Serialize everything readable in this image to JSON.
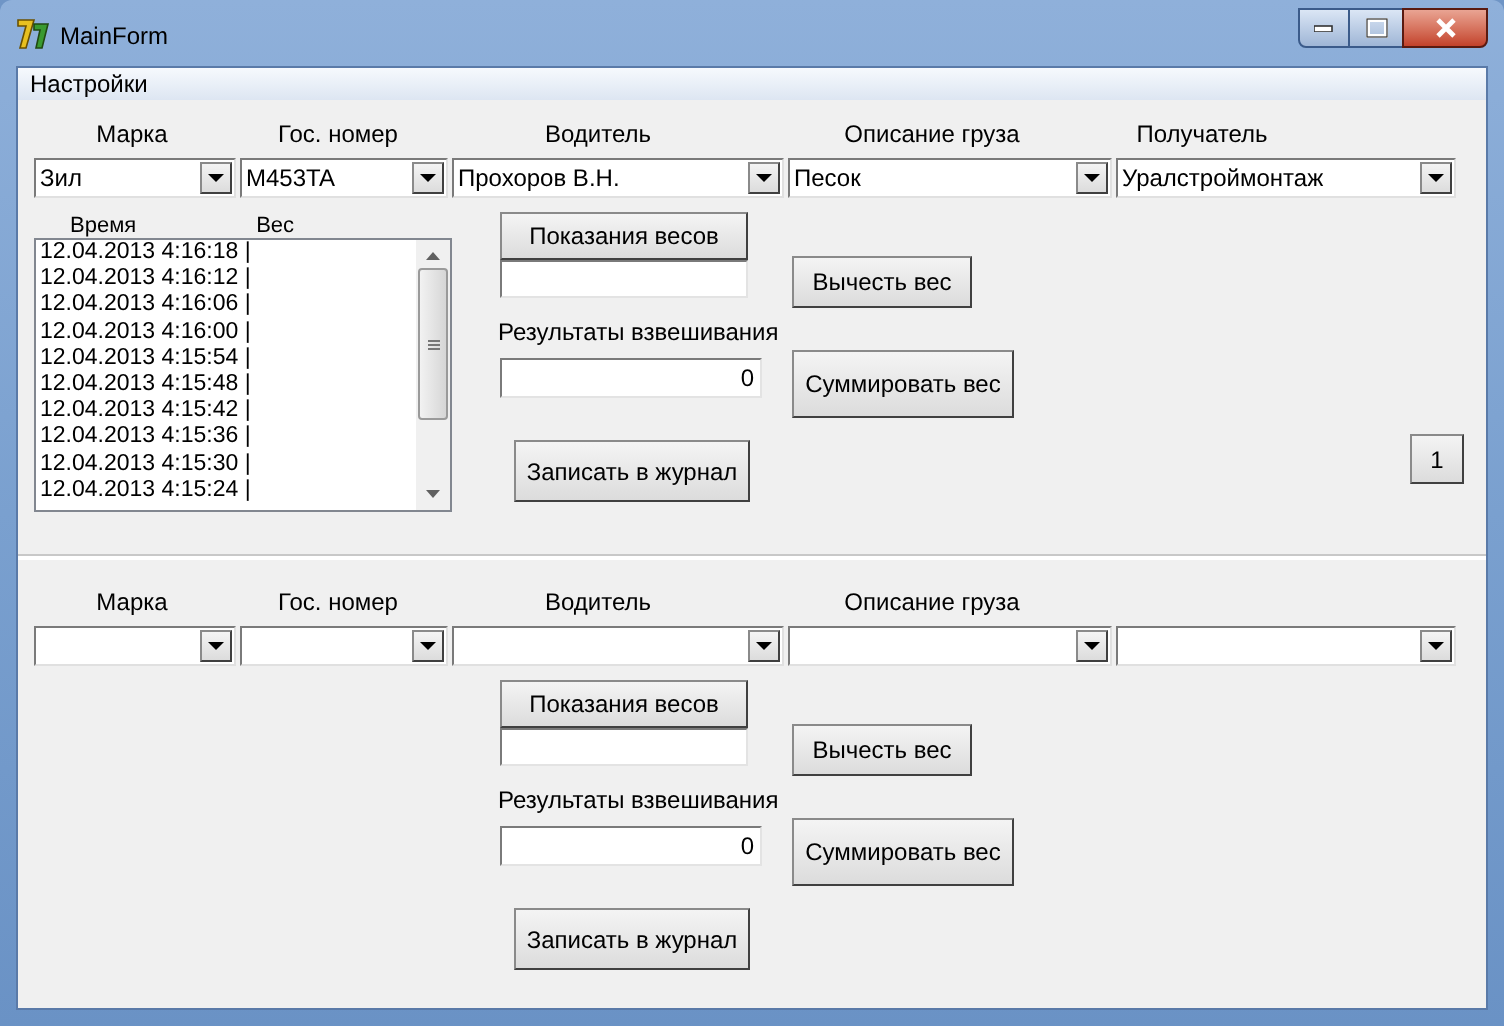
{
  "window": {
    "title": "MainForm"
  },
  "menu": [
    {
      "label": "Настройки"
    }
  ],
  "sections": [
    {
      "labels": [
        "Марка",
        "Гос. номер",
        "Водитель",
        "Описание груза",
        "Получатель"
      ],
      "combos": [
        {
          "kind": "dropdown",
          "value": "Зил"
        },
        {
          "kind": "dropdown",
          "value": "M453TA"
        },
        {
          "kind": "dropdown",
          "value": "Прохоров В.Н."
        },
        {
          "kind": "dropdown",
          "value": "Песок"
        },
        {
          "kind": "dropdown",
          "value": "Уралстроймонтаж"
        }
      ],
      "log": {
        "columns": [
          "Время",
          "Вес"
        ],
        "rows": [
          "12.04.2013 4:16:18 |",
          "12.04.2013 4:16:12 |",
          "12.04.2013 4:16:06 |",
          "12.04.2013 4:16:00 |",
          "12.04.2013 4:15:54 |",
          "12.04.2013 4:15:48 |",
          "12.04.2013 4:15:42 |",
          "12.04.2013 4:15:36 |",
          "12.04.2013 4:15:30 |",
          "12.04.2013 4:15:24 |"
        ]
      },
      "scale_button": "Показания весов",
      "result_label": "Результаты взвешивания",
      "result": {
        "value": "0"
      },
      "subtract_button": "Вычесть вес",
      "sum_button": "Суммировать вес",
      "journal_button": "Записать в журнал",
      "page_button": "1"
    },
    {
      "labels": [
        "Марка",
        "Гос. номер",
        "Водитель",
        "Описание груза"
      ],
      "combos": [
        {
          "kind": "dropdown"
        },
        {
          "kind": "dropdown"
        },
        {
          "kind": "dropdown"
        },
        {
          "kind": "dropdown"
        },
        {
          "kind": "dropdown"
        }
      ],
      "scale_button": "Показания весов",
      "result_label": "Результаты взвешивания",
      "result": {
        "value": "0"
      },
      "subtract_button": "Вычесть вес",
      "sum_button": "Суммировать вес",
      "journal_button": "Записать в журнал"
    }
  ]
}
